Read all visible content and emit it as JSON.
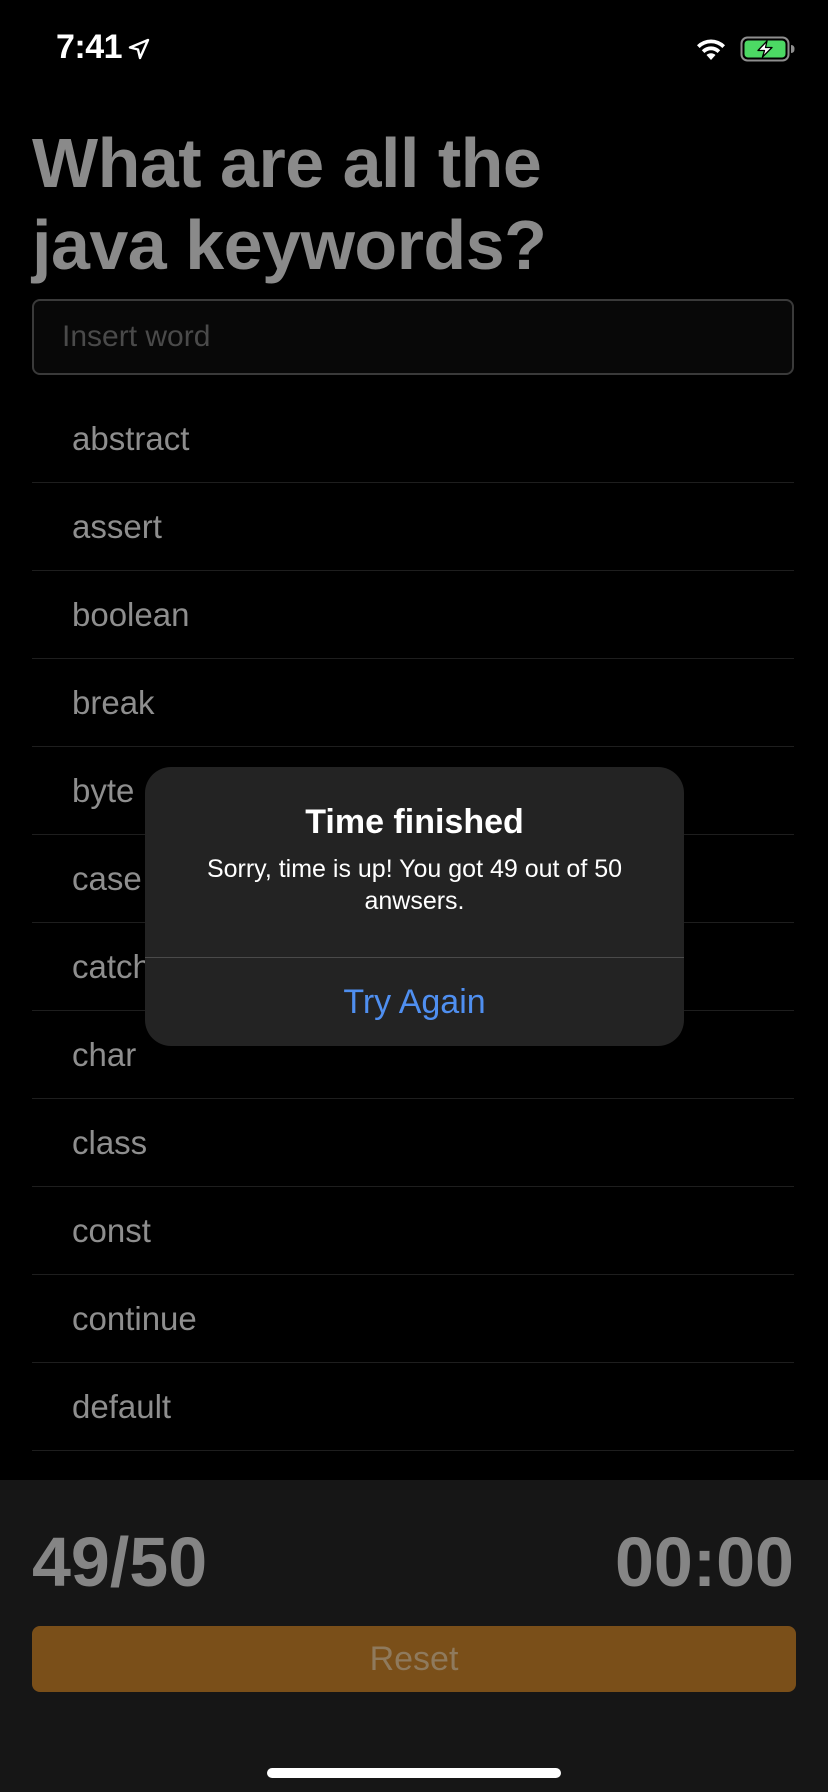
{
  "status_bar": {
    "time": "7:41",
    "icons": [
      "location-arrow-icon",
      "wifi-icon",
      "battery-charging-icon"
    ],
    "battery_color": "#4cd964"
  },
  "title": "What are all the java keywords?",
  "input": {
    "placeholder": "Insert word",
    "value": ""
  },
  "keywords": [
    "abstract",
    "assert",
    "boolean",
    "break",
    "byte",
    "case",
    "catch",
    "char",
    "class",
    "const",
    "continue",
    "default"
  ],
  "bottom": {
    "score": "49/50",
    "timer": "00:00",
    "reset_label": "Reset",
    "reset_color": "#7a4f19"
  },
  "alert": {
    "title": "Time finished",
    "message": "Sorry, time is up! You got 49 out of 50 anwsers.",
    "action_label": "Try Again",
    "action_color": "#4f8ff0"
  }
}
